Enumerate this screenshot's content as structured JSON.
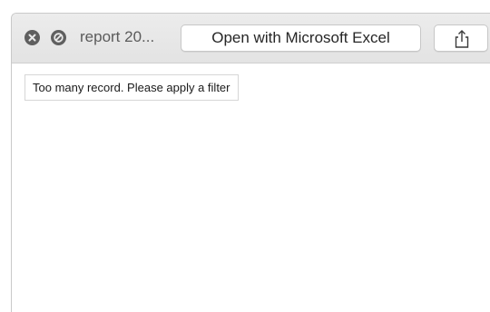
{
  "titlebar": {
    "title": "report 20...",
    "open_button_label": "Open with Microsoft Excel",
    "icons": {
      "close": "close-icon",
      "fullscreen": "fullscreen-icon",
      "share": "share-icon"
    }
  },
  "content": {
    "message": "Too many record. Please apply a filter"
  },
  "colors": {
    "titlebar_bg": "#e6e6e6",
    "icon_gray": "#5f5f5f",
    "button_border": "#c7c7c7"
  }
}
